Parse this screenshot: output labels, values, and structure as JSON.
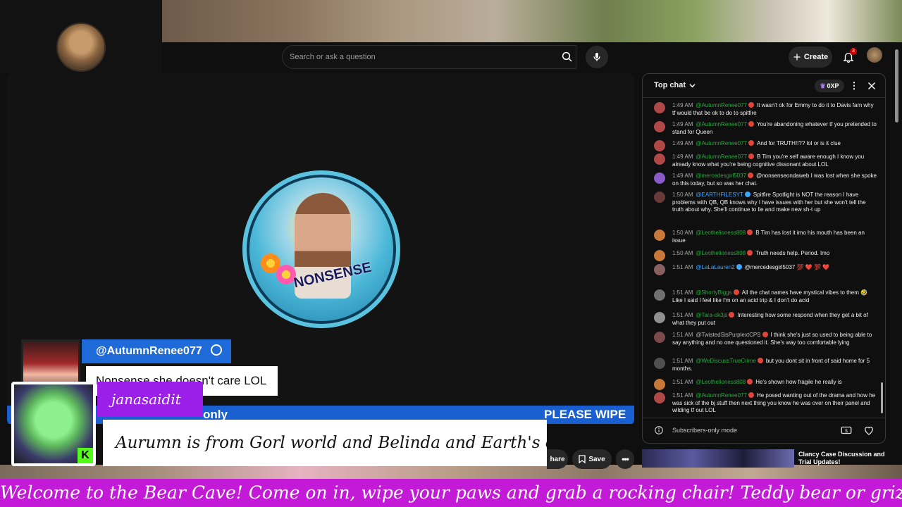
{
  "topbar": {
    "search_placeholder": "Search or ask a question",
    "create_label": "Create",
    "notification_count": "3"
  },
  "video": {
    "logo_text": "NONSENSE",
    "chat_overlay": {
      "author": "@AutumnRenee077",
      "message": "Nonsense she doesn't care LOL"
    },
    "ticker_left": "only",
    "ticker_right": "PLEASE WIPE Y",
    "featured": {
      "author": "janasaidit",
      "message": "Aurumn is from Gorl world and Belinda and Earth's chats"
    },
    "buttons": {
      "share": "hare",
      "save": "Save"
    }
  },
  "chat": {
    "title": "Top chat",
    "xp": "0XP",
    "footer_mode": "Subscribers-only mode",
    "messages": [
      {
        "time": "1:49 AM",
        "author": "@AutumnRenee077",
        "author_color": "green",
        "text": "It wasn't ok for Emmy to do it to Davis fam why tf would that be ok to do to spitfire",
        "avatar_color": "#b04848"
      },
      {
        "time": "1:49 AM",
        "author": "@AutumnRenee077",
        "author_color": "green",
        "text": "You're abandoning whatever tf you pretended to stand for Queen",
        "avatar_color": "#b04848"
      },
      {
        "time": "1:49 AM",
        "author": "@AutumnRenee077",
        "author_color": "green",
        "text": "And for TRUTH!!?? lol or is it clue",
        "avatar_color": "#b04848"
      },
      {
        "time": "1:49 AM",
        "author": "@AutumnRenee077",
        "author_color": "green",
        "text": "B Tim you're self aware enough I know you already know what you're being cognitive dissonant about LOL",
        "avatar_color": "#b04848"
      },
      {
        "time": "1:49 AM",
        "author": "@mercedesgirl5037",
        "author_color": "green",
        "text": "@nonsenseondaweb I was lost when she spoke on this today, but so was her chat.",
        "avatar_color": "#8a5ac8"
      },
      {
        "time": "1:50 AM",
        "author": "@EARTHFILESYT",
        "author_color": "blue",
        "text": "Spitfire Spotlight is NOT the reason I have problems with QB, QB knows why I have issues with her but she won't tell the truth about why. She'll continue to lie and make new sh-t up",
        "avatar_color": "#6a3a3a"
      },
      {
        "time": "1:50 AM",
        "author": "@Leothelioness808",
        "author_color": "green",
        "text": "B Tim has lost it imo his mouth has been an issue",
        "avatar_color": "#c87838"
      },
      {
        "time": "1:50 AM",
        "author": "@Leothelioness808",
        "author_color": "green",
        "text": "Truth needs help. Period. Imo",
        "avatar_color": "#c87838"
      },
      {
        "time": "1:51 AM",
        "author": "@LaLaLauren2",
        "author_color": "blue",
        "text": "@mercedesgirl5037 💯 ❤️ 💯 ❤️",
        "avatar_color": "#886060"
      },
      {
        "time": "1:51 AM",
        "author": "@ShortyBiggs",
        "author_color": "green",
        "text": "All the chat names have mystical vibes to them 🤣 Like I said I feel like I'm on an acid trip & I don't do acid",
        "avatar_color": "#707070"
      },
      {
        "time": "1:51 AM",
        "author": "@Tara-ok3js",
        "author_color": "green",
        "text": "Interesting how some respond when they get a bit of what they put out",
        "avatar_color": "#909090"
      },
      {
        "time": "1:51 AM",
        "author": "@TwistedSisPurplextCPS",
        "author_color": "grey",
        "text": "I think she's just so used to being able to say anything and no one questioned it. She's way too comfortable lying",
        "avatar_color": "#7a4a4a"
      },
      {
        "time": "1:51 AM",
        "author": "@WeDiscussTrueCrime",
        "author_color": "green",
        "text": "but you dont sit in front of said home for 5 months.",
        "avatar_color": "#505050"
      },
      {
        "time": "1:51 AM",
        "author": "@Leothelioness808",
        "author_color": "green",
        "text": "He's shown how fragile he really is",
        "avatar_color": "#c87838"
      },
      {
        "time": "1:51 AM",
        "author": "@AutumnRenee077",
        "author_color": "green",
        "text": "He posed wanting out of the drama and how he was sick of the bj stuff then next thing you know he was over on their panel and wilding tf out LOL",
        "avatar_color": "#b04848"
      }
    ]
  },
  "related": {
    "title": "Clancy Case Discussion and Trial Updates!"
  },
  "marquee": {
    "text": "Welcome to the Bear Cave! Come on in, wipe your paws and grab a rocking chair! Teddy bear or grizzly bear, it all depen"
  },
  "colors": {
    "accent_purple": "#c21ad6",
    "overlay_blue": "#1f6ad9",
    "featured_purple": "#9b1fe8",
    "chat_green": "#2ba640"
  }
}
